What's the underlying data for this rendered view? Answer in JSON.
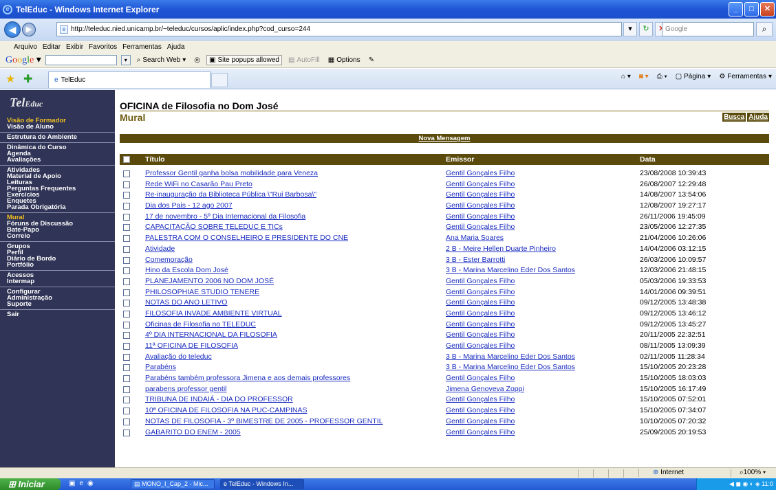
{
  "window": {
    "title": "TelEduc - Windows Internet Explorer"
  },
  "address": {
    "url": "http://teleduc.nied.unicamp.br/~teleduc/cursos/aplic/index.php?cod_curso=244",
    "search_placeholder": "Google"
  },
  "menu": [
    "Arquivo",
    "Editar",
    "Exibir",
    "Favoritos",
    "Ferramentas",
    "Ajuda"
  ],
  "google_bar": {
    "logo": "Google",
    "search_web": "Search Web",
    "popups": "Site popups allowed",
    "autofill": "AutoFill",
    "options": "Options"
  },
  "tab": {
    "label": "TelEduc"
  },
  "ie_tools": {
    "pagina": "Página",
    "ferramentas": "Ferramentas"
  },
  "sidebar": {
    "logo_a": "Tel",
    "logo_b": "Educ",
    "groups": [
      [
        "Visão de Formador",
        "Visão de Aluno"
      ],
      [
        "Estrutura do Ambiente"
      ],
      [
        "Dinâmica do Curso",
        "Agenda",
        "Avaliações"
      ],
      [
        "Atividades",
        "Material de Apoio",
        "Leituras",
        "Perguntas Frequentes",
        "Exercícios",
        "Enquetes",
        "Parada Obrigatória"
      ],
      [
        "Mural",
        "Fóruns de Discussão",
        "Bate-Papo",
        "Correio"
      ],
      [
        "Grupos",
        "Perfil",
        "Diário de Bordo",
        "Portfólio"
      ],
      [
        "Acessos",
        "Intermap"
      ],
      [
        "Configurar",
        "Administração",
        "Suporte"
      ],
      [
        "Sair"
      ]
    ]
  },
  "main": {
    "course_title": "OFICINA de Filosofia no Dom José",
    "section": "Mural",
    "busca": "Busca",
    "ajuda": "Ajuda",
    "nova": "Nova Mensagem",
    "col_titulo": "Título",
    "col_emissor": "Emissor",
    "col_data": "Data"
  },
  "rows": [
    [
      "Professor Gentil ganha bolsa mobilidade para Veneza",
      "Gentil Gonçales Filho",
      "23/08/2008 10:39:43"
    ],
    [
      "Rede WiFi no Casarão Pau Preto",
      "Gentil Gonçales Filho",
      "26/08/2007 12:29:48"
    ],
    [
      "Re-inauguração da Biblioteca Pública \\\"Rui Barbosa\\\"",
      "Gentil Gonçales Filho",
      "14/08/2007 13:54:06"
    ],
    [
      "Dia dos Pais - 12 ago 2007",
      "Gentil Gonçales Filho",
      "12/08/2007 19:27:17"
    ],
    [
      "17 de novembro - 5º Dia Internacional da Filosofia",
      "Gentil Gonçales Filho",
      "26/11/2006 19:45:09"
    ],
    [
      "CAPACITAÇÃO SOBRE TELEDUC E TICs",
      "Gentil Gonçales Filho",
      "23/05/2006 12:27:35"
    ],
    [
      "PALESTRA COM O CONSELHEIRO E PRESIDENTE DO CNE",
      "Ana Maria Soares",
      "21/04/2006 10:26:06"
    ],
    [
      "Atividade",
      "2 B - Meire Hellen Duarte Pinheiro",
      "14/04/2006 03:12:15"
    ],
    [
      "Comemoração",
      "3 B - Ester Barrotti",
      "26/03/2006 10:09:57"
    ],
    [
      "Hino da Escola Dom José",
      "3 B - Marina Marcelino Eder Dos Santos",
      "12/03/2006 21:48:15"
    ],
    [
      "PLANEJAMENTO 2006 NO DOM JOSÉ",
      "Gentil Gonçales Filho",
      "05/03/2006 19:33:53"
    ],
    [
      "PHILOSOPHIAE STUDIO TENERE",
      "Gentil Gonçales Filho",
      "14/01/2006 09:39:51"
    ],
    [
      "NOTAS DO ANO LETIVO",
      "Gentil Gonçales Filho",
      "09/12/2005 13:48:38"
    ],
    [
      "FILOSOFIA INVADE AMBIENTE VIRTUAL",
      "Gentil Gonçales Filho",
      "09/12/2005 13:46:12"
    ],
    [
      "Oficinas de Filosofia no TELEDUC",
      "Gentil Gonçales Filho",
      "09/12/2005 13:45:27"
    ],
    [
      "4º DIA INTERNACIONAL DA FILOSOFIA",
      "Gentil Gonçales Filho",
      "20/11/2005 22:32:51"
    ],
    [
      "11ª OFICINA DE FILOSOFIA",
      "Gentil Gonçales Filho",
      "08/11/2005 13:09:39"
    ],
    [
      "Avaliação do teleduc",
      "3 B - Marina Marcelino Eder Dos Santos",
      "02/11/2005 11:28:34"
    ],
    [
      "Parabéns",
      "3 B - Marina Marcelino Eder Dos Santos",
      "15/10/2005 20:23:28"
    ],
    [
      "Parabéns também professora Jimena e aos demais professores",
      "Gentil Gonçales Filho",
      "15/10/2005 18:03:03"
    ],
    [
      "parabens professor gentil",
      "Jimena Genoveva Zoppi",
      "15/10/2005 16:17:49"
    ],
    [
      "TRIBUNA DE INDAIÁ - DIA DO PROFESSOR",
      "Gentil Gonçales Filho",
      "15/10/2005 07:52:01"
    ],
    [
      "10ª OFICINA DE FILOSOFIA NA PUC-CAMPINAS",
      "Gentil Gonçales Filho",
      "15/10/2005 07:34:07"
    ],
    [
      "NOTAS DE FILOSOFIA - 3º BIMESTRE DE 2005 - PROFESSOR GENTIL",
      "Gentil Gonçales Filho",
      "10/10/2005 07:20:32"
    ],
    [
      "GABARITO DO ENEM - 2005",
      "Gentil Gonçales Filho",
      "25/09/2005 20:19:53"
    ]
  ],
  "status": {
    "zone": "Internet",
    "zoom": "100%"
  },
  "taskbar": {
    "start": "Iniciar",
    "task1": "MONO_I_Cap_2 - Mic...",
    "task2": "TelEduc - Windows In...",
    "clock": "11:0"
  }
}
